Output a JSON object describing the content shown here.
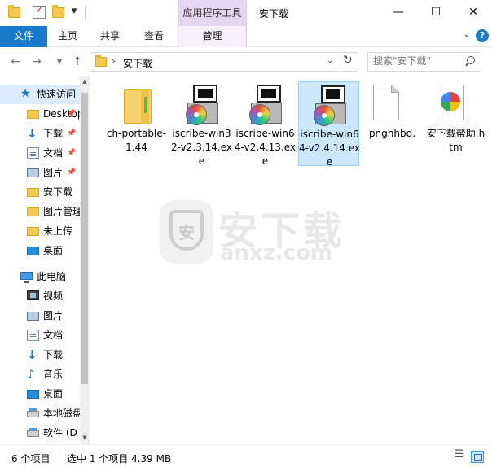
{
  "titlebar": {
    "title": "安下载",
    "context_tab_header": "应用程序工具",
    "minimize": "—",
    "maximize": "☐",
    "close": "✕"
  },
  "ribbon": {
    "tabs": [
      {
        "label": "文件"
      },
      {
        "label": "主页"
      },
      {
        "label": "共享"
      },
      {
        "label": "查看"
      },
      {
        "label": "管理"
      }
    ],
    "help": "?"
  },
  "navigation": {
    "address_path": "安下载",
    "search_placeholder": "搜索\"安下载\""
  },
  "sidebar": {
    "items": [
      {
        "label": "快速访问",
        "icon": "star-icon",
        "pinned": false
      },
      {
        "label": "Desktop",
        "icon": "folder-icon",
        "pinned": true
      },
      {
        "label": "下载",
        "icon": "download-arrow-icon",
        "pinned": true
      },
      {
        "label": "文档",
        "icon": "document-icon",
        "pinned": true
      },
      {
        "label": "图片",
        "icon": "picture-icon",
        "pinned": true
      },
      {
        "label": "安下载",
        "icon": "folder-icon",
        "pinned": false
      },
      {
        "label": "图片管理",
        "icon": "folder-icon",
        "pinned": false
      },
      {
        "label": "未上传",
        "icon": "folder-icon",
        "pinned": false
      },
      {
        "label": "桌面",
        "icon": "desktop-icon",
        "pinned": false
      },
      {
        "label": "此电脑",
        "icon": "computer-icon",
        "pinned": false
      },
      {
        "label": "视频",
        "icon": "video-icon",
        "pinned": false
      },
      {
        "label": "图片",
        "icon": "picture-icon",
        "pinned": false
      },
      {
        "label": "文档",
        "icon": "document-icon",
        "pinned": false
      },
      {
        "label": "下载",
        "icon": "download-arrow-icon",
        "pinned": false
      },
      {
        "label": "音乐",
        "icon": "music-icon",
        "pinned": false
      },
      {
        "label": "桌面",
        "icon": "desktop-icon",
        "pinned": false
      },
      {
        "label": "本地磁盘",
        "icon": "drive-icon",
        "pinned": false
      },
      {
        "label": "软件 (D",
        "icon": "drive-icon",
        "pinned": false
      }
    ],
    "pin_glyph": "📌"
  },
  "files": [
    {
      "name": "ch-portable-1.44",
      "icon": "folder-icon"
    },
    {
      "name": "iscribe-win32-v2.3.14.exe",
      "icon": "installer-icon"
    },
    {
      "name": "iscribe-win64-v2.4.13.exe",
      "icon": "installer-icon"
    },
    {
      "name": "iscribe-win64-v2.4.14.exe",
      "icon": "installer-icon",
      "selected": true
    },
    {
      "name": "pnghhbd.",
      "icon": "blank-file-icon"
    },
    {
      "name": "安下载帮助.htm",
      "icon": "html-file-icon"
    }
  ],
  "watermark": {
    "text": "安下载",
    "sub": "anxz.com",
    "badge_char": "安"
  },
  "status": {
    "count": "6 个项目",
    "selection": "选中 1 个项目  4.39 MB"
  }
}
